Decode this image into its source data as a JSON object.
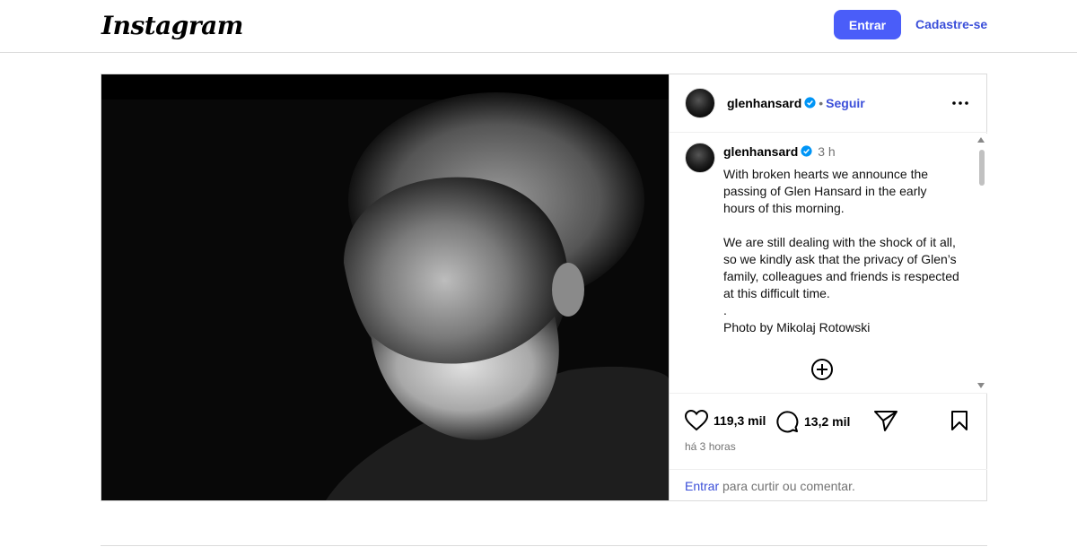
{
  "header": {
    "logo": "Instagram",
    "login_button": "Entrar",
    "signup_link": "Cadastre-se"
  },
  "post": {
    "image_description": "Black and white portrait photo",
    "author": {
      "username": "glenhansard",
      "verified": true,
      "follow_label": "Seguir",
      "dot": "•"
    },
    "caption": {
      "username": "glenhansard",
      "time": "3 h",
      "text": "With broken hearts we announce the passing of Glen Hansard in the early hours of this morning.\n\nWe are still dealing with the shock of it all, so we kindly ask that the privacy of Glen’s family, colleagues and friends is respected at this difficult time.\n.\nPhoto by Mikolaj Rotowski"
    },
    "likes": "119,3 mil",
    "comments": "13,2 mil",
    "posted_ago": "há 3 horas",
    "login_prompt": {
      "link": "Entrar",
      "text": " para curtir ou comentar."
    }
  },
  "colors": {
    "accent": "#4a5df9",
    "link": "#3b4fd9",
    "verified": "#0095f6"
  },
  "icons": [
    "more-options-icon",
    "verified-icon",
    "add-comment-icon",
    "heart-icon",
    "comment-icon",
    "share-icon",
    "bookmark-icon"
  ]
}
